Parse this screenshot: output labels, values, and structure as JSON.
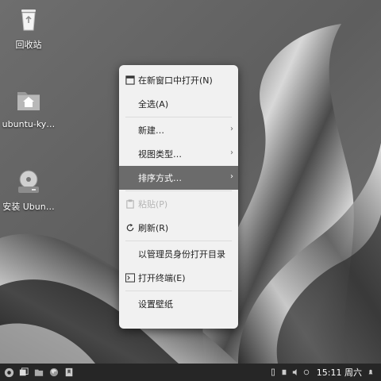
{
  "desktop": {
    "icons": [
      {
        "label": "回收站",
        "icon": "trash-icon"
      },
      {
        "label": "ubuntu-ky…",
        "icon": "home-folder-icon"
      },
      {
        "label": "安装 Ubun…",
        "icon": "installer-disk-icon"
      }
    ]
  },
  "context_menu": {
    "items": [
      {
        "label": "在新窗口中打开(N)",
        "icon": "new-window-icon"
      },
      {
        "label": "全选(A)"
      },
      {
        "label": "新建…",
        "submenu": true
      },
      {
        "label": "视图类型…",
        "submenu": true
      },
      {
        "label": "排序方式…",
        "submenu": true,
        "active": true
      },
      {
        "label": "粘贴(P)",
        "icon": "clipboard-icon",
        "disabled": true
      },
      {
        "label": "刷新(R)",
        "icon": "refresh-icon"
      },
      {
        "label": "以管理员身份打开目录"
      },
      {
        "label": "打开终端(E)",
        "icon": "terminal-icon"
      },
      {
        "label": "设置壁纸"
      }
    ],
    "submenu_arrow": "›"
  },
  "taskbar": {
    "clock": "15:11 周六",
    "launchers": [
      "start-menu-icon",
      "window-switch-icon",
      "file-manager-icon",
      "firefox-icon",
      "bookmark-icon"
    ],
    "tray_icons": [
      "network-icon",
      "usb-icon",
      "volume-icon",
      "notification-icon",
      "notification-center-icon"
    ]
  }
}
